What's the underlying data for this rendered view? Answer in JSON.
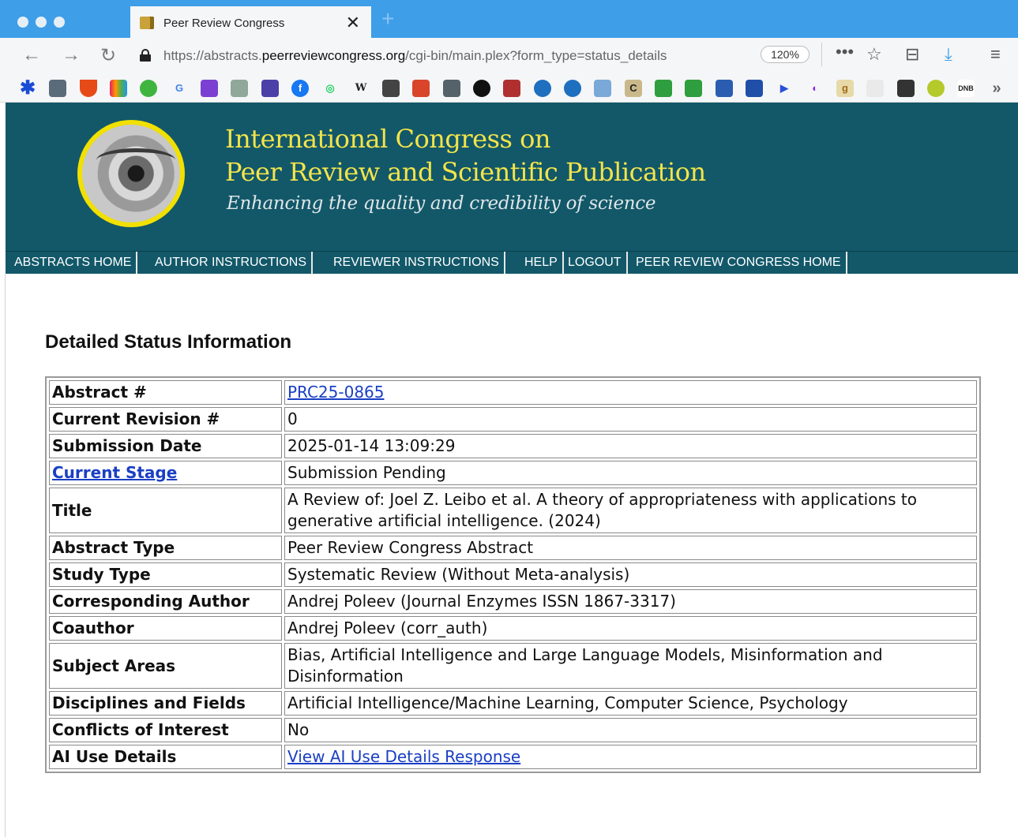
{
  "browser": {
    "tab_title": "Peer Review Congress",
    "url_prefix": "https://abstracts.",
    "url_domain": "peerreviewcongress.org",
    "url_path": "/cgi-bin/main.plex?form_type=status_details",
    "zoom": "120%",
    "tab_close": "✕",
    "new_tab": "+"
  },
  "site": {
    "title_line1": "International Congress on",
    "title_line2": "Peer Review and Scientific Publication",
    "tagline": "Enhancing the quality and credibility of science"
  },
  "menu": [
    "ABSTRACTS HOME",
    "AUTHOR INSTRUCTIONS",
    "REVIEWER INSTRUCTIONS",
    "HELP",
    "LOGOUT",
    "PEER REVIEW CONGRESS HOME"
  ],
  "page": {
    "heading": "Detailed Status Information"
  },
  "rows": [
    {
      "label": "Abstract #",
      "value": "PRC25-0865",
      "value_link": true
    },
    {
      "label": "Current Revision #",
      "value": "0"
    },
    {
      "label": "Submission Date",
      "value": "2025-01-14 13:09:29"
    },
    {
      "label": "Current Stage",
      "value": "Submission Pending",
      "label_link": true
    },
    {
      "label": "Title",
      "value": "A Review of: Joel Z. Leibo et al. A theory of appropriateness with applications to generative artificial intelligence. (2024)"
    },
    {
      "label": "Abstract Type",
      "value": "Peer Review Congress Abstract"
    },
    {
      "label": "Study Type",
      "value": "Systematic Review (Without Meta-analysis)"
    },
    {
      "label": "Corresponding Author",
      "value": "Andrej Poleev (Journal Enzymes ISSN 1867-3317)"
    },
    {
      "label": "Coauthor",
      "value": "Andrej Poleev (corr_auth)"
    },
    {
      "label": "Subject Areas",
      "value": "Bias, Artificial Intelligence and Large Language Models, Misinformation and Disinformation"
    },
    {
      "label": "Disciplines and Fields",
      "value": "Artificial Intelligence/Machine Learning, Computer Science, Psychology"
    },
    {
      "label": "Conflicts of Interest",
      "value": "No"
    },
    {
      "label": "AI Use Details",
      "value": "View AI Use Details Response",
      "value_link": true
    }
  ]
}
